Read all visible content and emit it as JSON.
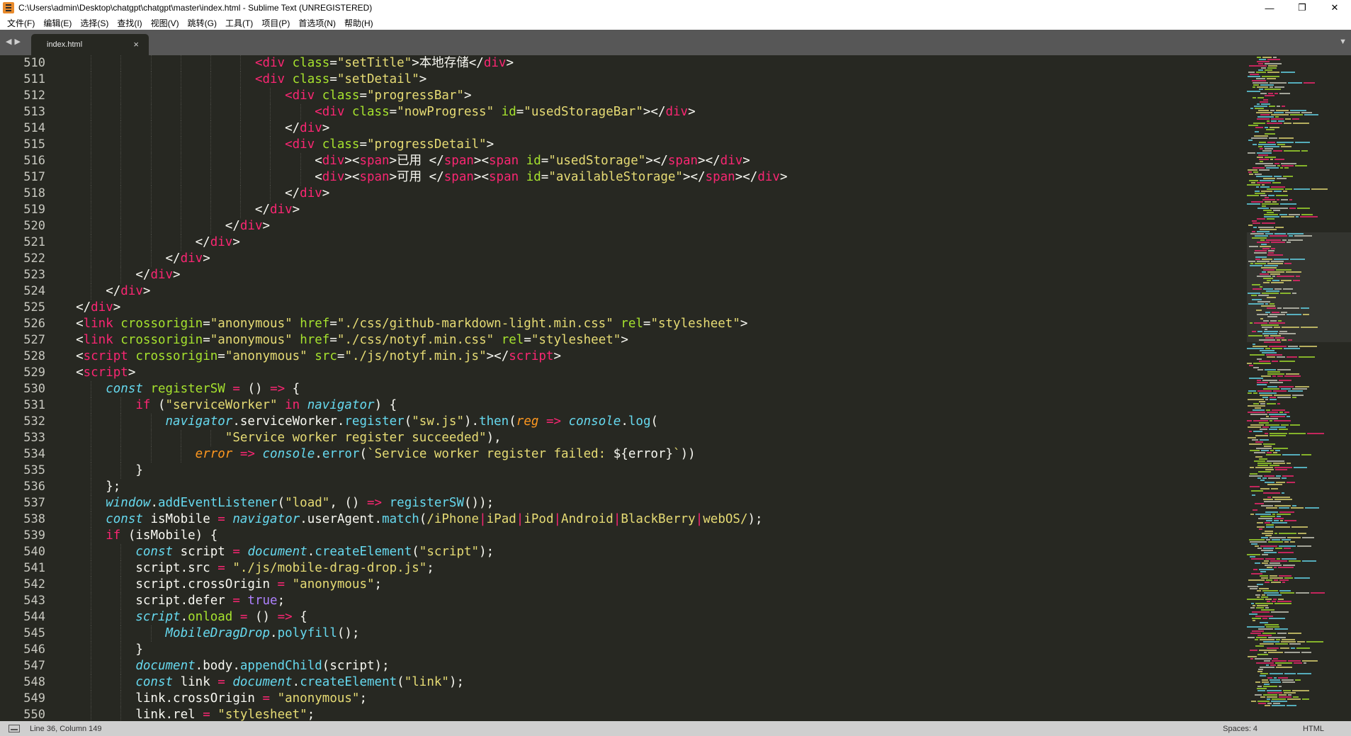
{
  "window": {
    "title": "C:\\Users\\admin\\Desktop\\chatgpt\\chatgpt\\master\\index.html - Sublime Text (UNREGISTERED)",
    "controls": {
      "minimize": "—",
      "restore": "❐",
      "close": "✕"
    }
  },
  "menu": {
    "items": [
      "文件(F)",
      "编辑(E)",
      "选择(S)",
      "查找(I)",
      "视图(V)",
      "跳转(G)",
      "工具(T)",
      "项目(P)",
      "首选项(N)",
      "帮助(H)"
    ]
  },
  "tabs": {
    "nav_left": "◀",
    "nav_right": "▶",
    "active": {
      "label": "index.html",
      "close": "×"
    },
    "dropdown": "▼"
  },
  "editor": {
    "line_numbers": [
      "510",
      "511",
      "512",
      "513",
      "514",
      "515",
      "516",
      "517",
      "518",
      "519",
      "520",
      "521",
      "522",
      "523",
      "524",
      "525",
      "526",
      "527",
      "528",
      "529",
      "530",
      "531",
      "532",
      "533",
      "534",
      "535",
      "536",
      "537",
      "538",
      "539",
      "540",
      "541",
      "542",
      "543",
      "544",
      "545",
      "546",
      "547",
      "548",
      "549",
      "550"
    ],
    "lines": [
      [
        [
          "",
          "                          "
        ],
        [
          "tg",
          "<div "
        ],
        [
          "at",
          "class"
        ],
        [
          "",
          "="
        ],
        [
          "st",
          "\"setTitle\""
        ],
        [
          "",
          ">本地存储</"
        ],
        [
          "tg",
          "div"
        ],
        [
          "",
          ">"
        ]
      ],
      [
        [
          "",
          "                          "
        ],
        [
          "tg",
          "<div "
        ],
        [
          "at",
          "class"
        ],
        [
          "",
          "="
        ],
        [
          "st",
          "\"setDetail\""
        ],
        [
          "",
          ">"
        ]
      ],
      [
        [
          "",
          "                              "
        ],
        [
          "tg",
          "<div "
        ],
        [
          "at",
          "class"
        ],
        [
          "",
          "="
        ],
        [
          "st",
          "\"progressBar\""
        ],
        [
          "",
          ">"
        ]
      ],
      [
        [
          "",
          "                                  "
        ],
        [
          "tg",
          "<div "
        ],
        [
          "at",
          "class"
        ],
        [
          "",
          "="
        ],
        [
          "st",
          "\"nowProgress\""
        ],
        [
          "",
          " "
        ],
        [
          "at",
          "id"
        ],
        [
          "",
          "="
        ],
        [
          "st",
          "\"usedStorageBar\""
        ],
        [
          "",
          "></"
        ],
        [
          "tg",
          "div"
        ],
        [
          "",
          ">"
        ]
      ],
      [
        [
          "",
          "                              </"
        ],
        [
          "tg",
          "div"
        ],
        [
          "",
          ">"
        ]
      ],
      [
        [
          "",
          "                              "
        ],
        [
          "tg",
          "<div "
        ],
        [
          "at",
          "class"
        ],
        [
          "",
          "="
        ],
        [
          "st",
          "\"progressDetail\""
        ],
        [
          "",
          ">"
        ]
      ],
      [
        [
          "",
          "                                  <"
        ],
        [
          "tg",
          "div"
        ],
        [
          "",
          "><"
        ],
        [
          "tg",
          "span"
        ],
        [
          "",
          ">已用 </"
        ],
        [
          "tg",
          "span"
        ],
        [
          "",
          "><"
        ],
        [
          "tg",
          "span "
        ],
        [
          "at",
          "id"
        ],
        [
          "",
          "="
        ],
        [
          "st",
          "\"usedStorage\""
        ],
        [
          "",
          "></"
        ],
        [
          "tg",
          "span"
        ],
        [
          "",
          "></"
        ],
        [
          "tg",
          "div"
        ],
        [
          "",
          ">"
        ]
      ],
      [
        [
          "",
          "                                  <"
        ],
        [
          "tg",
          "div"
        ],
        [
          "",
          "><"
        ],
        [
          "tg",
          "span"
        ],
        [
          "",
          ">可用 </"
        ],
        [
          "tg",
          "span"
        ],
        [
          "",
          "><"
        ],
        [
          "tg",
          "span "
        ],
        [
          "at",
          "id"
        ],
        [
          "",
          "="
        ],
        [
          "st",
          "\"availableStorage\""
        ],
        [
          "",
          "></"
        ],
        [
          "tg",
          "span"
        ],
        [
          "",
          "></"
        ],
        [
          "tg",
          "div"
        ],
        [
          "",
          ">"
        ]
      ],
      [
        [
          "",
          "                              </"
        ],
        [
          "tg",
          "div"
        ],
        [
          "",
          ">"
        ]
      ],
      [
        [
          "",
          "                          </"
        ],
        [
          "tg",
          "div"
        ],
        [
          "",
          ">"
        ]
      ],
      [
        [
          "",
          "                      </"
        ],
        [
          "tg",
          "div"
        ],
        [
          "",
          ">"
        ]
      ],
      [
        [
          "",
          "                  </"
        ],
        [
          "tg",
          "div"
        ],
        [
          "",
          ">"
        ]
      ],
      [
        [
          "",
          "              </"
        ],
        [
          "tg",
          "div"
        ],
        [
          "",
          ">"
        ]
      ],
      [
        [
          "",
          "          </"
        ],
        [
          "tg",
          "div"
        ],
        [
          "",
          ">"
        ]
      ],
      [
        [
          "",
          "      </"
        ],
        [
          "tg",
          "div"
        ],
        [
          "",
          ">"
        ]
      ],
      [
        [
          "",
          "  </"
        ],
        [
          "tg",
          "div"
        ],
        [
          "",
          ">"
        ]
      ],
      [
        [
          "",
          "  <"
        ],
        [
          "tg",
          "link "
        ],
        [
          "at",
          "crossorigin"
        ],
        [
          "",
          "="
        ],
        [
          "st",
          "\"anonymous\""
        ],
        [
          "",
          " "
        ],
        [
          "at",
          "href"
        ],
        [
          "",
          "="
        ],
        [
          "st",
          "\"./css/github-markdown-light.min.css\""
        ],
        [
          "",
          " "
        ],
        [
          "at",
          "rel"
        ],
        [
          "",
          "="
        ],
        [
          "st",
          "\"stylesheet\""
        ],
        [
          "",
          ">"
        ]
      ],
      [
        [
          "",
          "  <"
        ],
        [
          "tg",
          "link "
        ],
        [
          "at",
          "crossorigin"
        ],
        [
          "",
          "="
        ],
        [
          "st",
          "\"anonymous\""
        ],
        [
          "",
          " "
        ],
        [
          "at",
          "href"
        ],
        [
          "",
          "="
        ],
        [
          "st",
          "\"./css/notyf.min.css\""
        ],
        [
          "",
          " "
        ],
        [
          "at",
          "rel"
        ],
        [
          "",
          "="
        ],
        [
          "st",
          "\"stylesheet\""
        ],
        [
          "",
          ">"
        ]
      ],
      [
        [
          "",
          "  <"
        ],
        [
          "tg",
          "script "
        ],
        [
          "at",
          "crossorigin"
        ],
        [
          "",
          "="
        ],
        [
          "st",
          "\"anonymous\""
        ],
        [
          "",
          " "
        ],
        [
          "at",
          "src"
        ],
        [
          "",
          "="
        ],
        [
          "st",
          "\"./js/notyf.min.js\""
        ],
        [
          "",
          "></"
        ],
        [
          "tg",
          "script"
        ],
        [
          "",
          ">"
        ]
      ],
      [
        [
          "",
          "  <"
        ],
        [
          "tg",
          "script"
        ],
        [
          "",
          ">"
        ]
      ],
      [
        [
          "",
          "      "
        ],
        [
          "kw",
          "const"
        ],
        [
          "",
          " "
        ],
        [
          "fn",
          "registerSW"
        ],
        [
          "",
          " "
        ],
        [
          "op",
          "="
        ],
        [
          "",
          " () "
        ],
        [
          "op",
          "=>"
        ],
        [
          "",
          " {"
        ]
      ],
      [
        [
          "",
          "          "
        ],
        [
          "op",
          "if"
        ],
        [
          "",
          " ("
        ],
        [
          "st",
          "\"serviceWorker\""
        ],
        [
          "",
          " "
        ],
        [
          "op",
          "in"
        ],
        [
          "",
          " "
        ],
        [
          "gl",
          "navigator"
        ],
        [
          "",
          ") {"
        ]
      ],
      [
        [
          "",
          "              "
        ],
        [
          "gl",
          "navigator"
        ],
        [
          "",
          ".serviceWorker."
        ],
        [
          "fn2",
          "register"
        ],
        [
          "",
          "("
        ],
        [
          "st",
          "\"sw.js\""
        ],
        [
          "",
          ")."
        ],
        [
          "fn2",
          "then"
        ],
        [
          "",
          "("
        ],
        [
          "pa",
          "reg"
        ],
        [
          "",
          " "
        ],
        [
          "op",
          "=>"
        ],
        [
          "",
          " "
        ],
        [
          "gl",
          "console"
        ],
        [
          "",
          "."
        ],
        [
          "fn2",
          "log"
        ],
        [
          "",
          "("
        ]
      ],
      [
        [
          "",
          "                      "
        ],
        [
          "st",
          "\"Service worker register succeeded\""
        ],
        [
          "",
          "),"
        ]
      ],
      [
        [
          "",
          "                  "
        ],
        [
          "pa",
          "error"
        ],
        [
          "",
          " "
        ],
        [
          "op",
          "=>"
        ],
        [
          "",
          " "
        ],
        [
          "gl",
          "console"
        ],
        [
          "",
          "."
        ],
        [
          "fn2",
          "error"
        ],
        [
          "",
          "("
        ],
        [
          "st",
          "`Service worker register failed: "
        ],
        [
          "",
          "${error}"
        ],
        [
          "st",
          "`"
        ],
        [
          "",
          "))"
        ]
      ],
      [
        [
          "",
          "          }"
        ]
      ],
      [
        [
          "",
          "      };"
        ]
      ],
      [
        [
          "",
          "      "
        ],
        [
          "gl",
          "window"
        ],
        [
          "",
          "."
        ],
        [
          "fn2",
          "addEventListener"
        ],
        [
          "",
          "("
        ],
        [
          "st",
          "\"load\""
        ],
        [
          "",
          ", () "
        ],
        [
          "op",
          "=>"
        ],
        [
          "",
          " "
        ],
        [
          "fn2",
          "registerSW"
        ],
        [
          "",
          "());"
        ]
      ],
      [
        [
          "",
          "      "
        ],
        [
          "kw",
          "const"
        ],
        [
          "",
          " isMobile "
        ],
        [
          "op",
          "="
        ],
        [
          "",
          " "
        ],
        [
          "gl",
          "navigator"
        ],
        [
          "",
          ".userAgent."
        ],
        [
          "fn2",
          "match"
        ],
        [
          "",
          "("
        ],
        [
          "rx",
          "/iPhone"
        ],
        [
          "op",
          "|"
        ],
        [
          "rx",
          "iPad"
        ],
        [
          "op",
          "|"
        ],
        [
          "rx",
          "iPod"
        ],
        [
          "op",
          "|"
        ],
        [
          "rx",
          "Android"
        ],
        [
          "op",
          "|"
        ],
        [
          "rx",
          "BlackBerry"
        ],
        [
          "op",
          "|"
        ],
        [
          "rx",
          "webOS/"
        ],
        [
          "",
          ");"
        ]
      ],
      [
        [
          "",
          "      "
        ],
        [
          "op",
          "if"
        ],
        [
          "",
          " (isMobile) {"
        ]
      ],
      [
        [
          "",
          "          "
        ],
        [
          "kw",
          "const"
        ],
        [
          "",
          " script "
        ],
        [
          "op",
          "="
        ],
        [
          "",
          " "
        ],
        [
          "gl",
          "document"
        ],
        [
          "",
          "."
        ],
        [
          "fn2",
          "createElement"
        ],
        [
          "",
          "("
        ],
        [
          "st",
          "\"script\""
        ],
        [
          "",
          ");"
        ]
      ],
      [
        [
          "",
          "          script.src "
        ],
        [
          "op",
          "="
        ],
        [
          "",
          " "
        ],
        [
          "st",
          "\"./js/mobile-drag-drop.js\""
        ],
        [
          "",
          ";"
        ]
      ],
      [
        [
          "",
          "          script.crossOrigin "
        ],
        [
          "op",
          "="
        ],
        [
          "",
          " "
        ],
        [
          "st",
          "\"anonymous\""
        ],
        [
          "",
          ";"
        ]
      ],
      [
        [
          "",
          "          script.defer "
        ],
        [
          "op",
          "="
        ],
        [
          "",
          " "
        ],
        [
          "cn",
          "true"
        ],
        [
          "",
          ";"
        ]
      ],
      [
        [
          "",
          "          "
        ],
        [
          "gl",
          "script"
        ],
        [
          "",
          "."
        ],
        [
          "fn",
          "onload"
        ],
        [
          "",
          " "
        ],
        [
          "op",
          "="
        ],
        [
          "",
          " () "
        ],
        [
          "op",
          "=>"
        ],
        [
          "",
          " {"
        ]
      ],
      [
        [
          "",
          "              "
        ],
        [
          "gl",
          "MobileDragDrop"
        ],
        [
          "",
          "."
        ],
        [
          "fn2",
          "polyfill"
        ],
        [
          "",
          "();"
        ]
      ],
      [
        [
          "",
          "          }"
        ]
      ],
      [
        [
          "",
          "          "
        ],
        [
          "gl",
          "document"
        ],
        [
          "",
          ".body."
        ],
        [
          "fn2",
          "appendChild"
        ],
        [
          "",
          "(script);"
        ]
      ],
      [
        [
          "",
          "          "
        ],
        [
          "kw",
          "const"
        ],
        [
          "",
          " link "
        ],
        [
          "op",
          "="
        ],
        [
          "",
          " "
        ],
        [
          "gl",
          "document"
        ],
        [
          "",
          "."
        ],
        [
          "fn2",
          "createElement"
        ],
        [
          "",
          "("
        ],
        [
          "st",
          "\"link\""
        ],
        [
          "",
          ");"
        ]
      ],
      [
        [
          "",
          "          link.crossOrigin "
        ],
        [
          "op",
          "="
        ],
        [
          "",
          " "
        ],
        [
          "st",
          "\"anonymous\""
        ],
        [
          "",
          ";"
        ]
      ],
      [
        [
          "",
          "          link.rel "
        ],
        [
          "op",
          "="
        ],
        [
          "",
          " "
        ],
        [
          "st",
          "\"stylesheet\""
        ],
        [
          "",
          ";"
        ]
      ]
    ]
  },
  "status": {
    "position": "Line 36, Column 149",
    "indentation": "Spaces: 4",
    "syntax": "HTML"
  },
  "theme": {
    "background": "#272822",
    "tag": "#f92672",
    "attribute": "#a6e22e",
    "string": "#e6db74",
    "storage": "#66d9ef",
    "parameter": "#fd971f",
    "constant": "#ae81ff"
  }
}
